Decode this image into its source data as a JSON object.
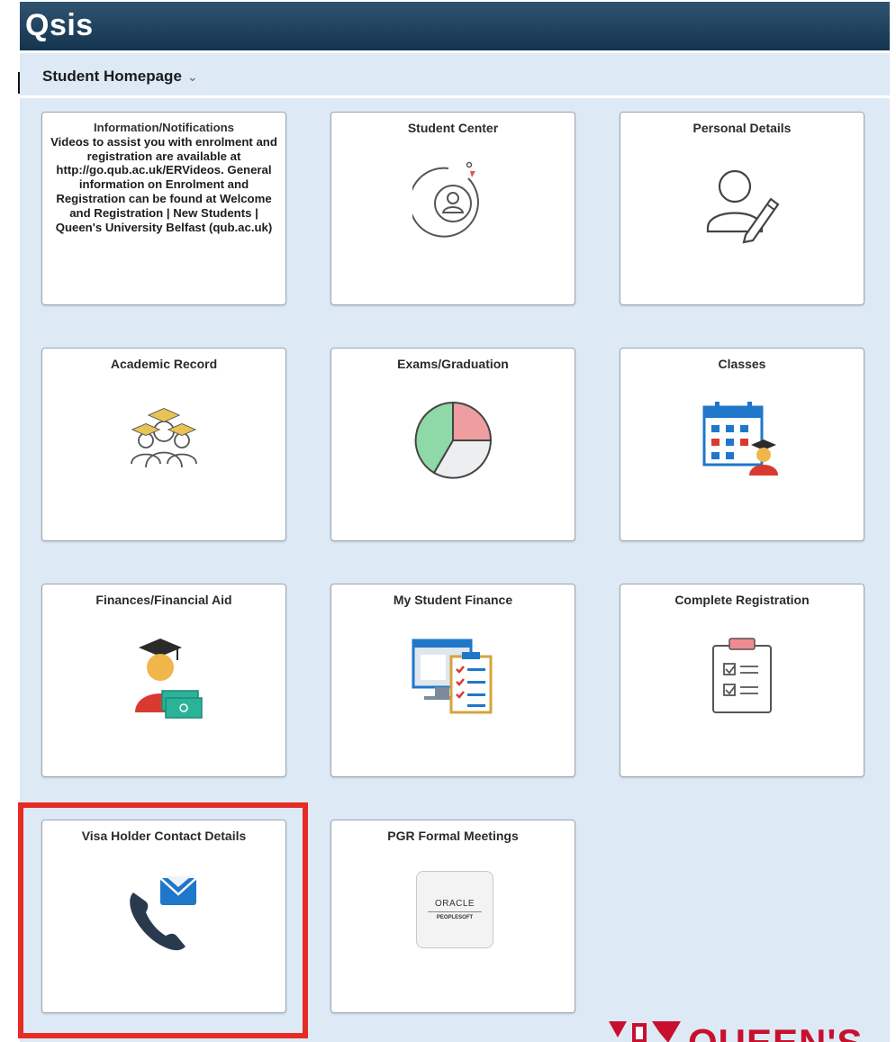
{
  "app": {
    "brand": "Qsis"
  },
  "page": {
    "title": "Student Homepage",
    "title_chevron": "⌄"
  },
  "tiles": [
    {
      "title": "Information/Notifications",
      "body": "Videos to assist you with enrolment and registration are available at http://go.qub.ac.uk/ERVideos. General information on Enrolment and Registration can be found at Welcome and Registration | New Students | Queen's University Belfast (qub.ac.uk)"
    },
    {
      "title": "Student Center",
      "icon": "student-center-icon"
    },
    {
      "title": "Personal Details",
      "icon": "person-pencil-icon"
    },
    {
      "title": "Academic Record",
      "icon": "graduates-group-icon"
    },
    {
      "title": "Exams/Graduation",
      "icon": "pie-chart-icon"
    },
    {
      "title": "Classes",
      "icon": "calendar-student-icon"
    },
    {
      "title": "Finances/Financial Aid",
      "icon": "graduate-money-icon"
    },
    {
      "title": "My Student Finance",
      "icon": "monitor-checklist-icon"
    },
    {
      "title": "Complete Registration",
      "icon": "clipboard-checklist-icon"
    },
    {
      "title": "Visa Holder Contact Details",
      "icon": "phone-envelope-icon"
    },
    {
      "title": "PGR Formal Meetings",
      "icon": "oracle-peoplesoft-icon",
      "logo_top": "ORACLE",
      "logo_bottom": "PEOPLESOFT"
    }
  ],
  "footer": {
    "logo_text": "QUEEN'S"
  },
  "colors": {
    "header": "#1f405c",
    "panel": "#dde9f5",
    "highlight": "#e52b24",
    "pie_pink": "#ee9ea0",
    "pie_green": "#8fd8a8",
    "calendar_blue": "#1f77c9",
    "finance_green": "#2bb39a",
    "accent_red": "#d93a30"
  }
}
